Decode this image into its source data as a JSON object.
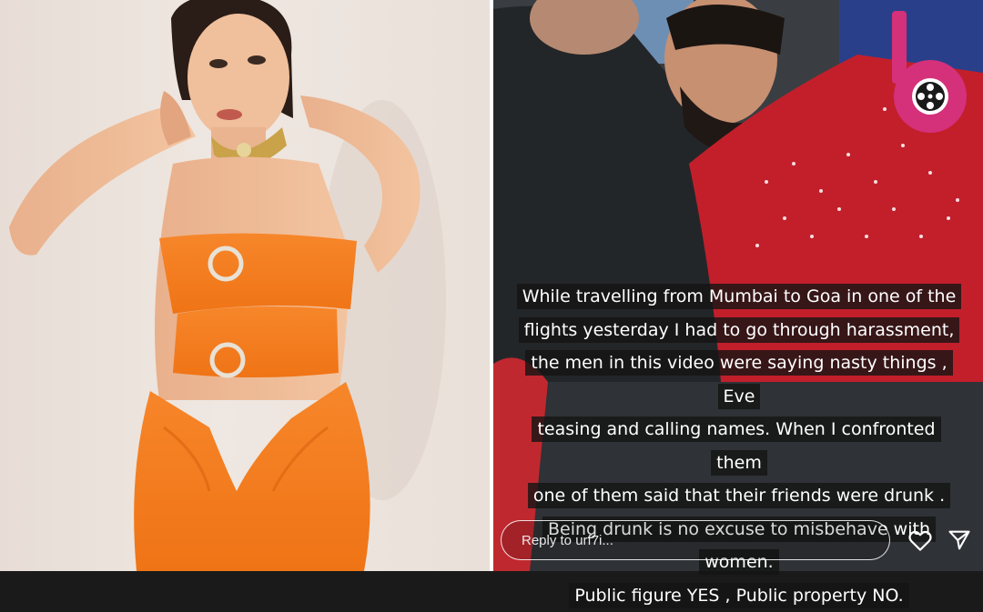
{
  "left_photo": {
    "description_icon": "woman-in-orange-dress-photo"
  },
  "story": {
    "photo_icon": "flight-video-frame",
    "lines": [
      "While travelling from Mumbai to Goa  in one of the",
      "flights yesterday I had to go through harassment,",
      "the men in this video were saying nasty things , Eve",
      "teasing and calling names. When I confronted them",
      "one of them said that their friends were drunk .",
      "Being drunk is no excuse to misbehave with women.",
      "Public figure YES , Public property NO."
    ],
    "reply_placeholder": "Reply to urf7i..."
  },
  "icons": {
    "heart": "heart-icon",
    "send": "send-icon",
    "logo": "brand-logo-icon"
  },
  "colors": {
    "logo_pink": "#d5307a",
    "dress_orange": "#f47b1c",
    "shirt_red": "#c21f2b"
  }
}
